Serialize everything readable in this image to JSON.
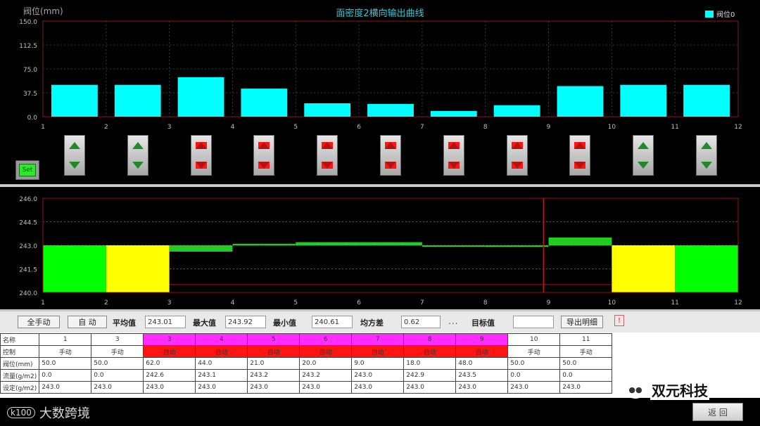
{
  "top_chart": {
    "title": "面密度2横向输出曲线",
    "unit_label": "阀位(mm)",
    "legend_label": "阀位0",
    "y_ticks": [
      "150.0",
      "112.5",
      "75.0",
      "37.5",
      "0.0"
    ],
    "x_ticks": [
      "1",
      "2",
      "3",
      "4",
      "5",
      "6",
      "7",
      "8",
      "9",
      "10",
      "11",
      "12"
    ],
    "set_label": "Set",
    "arrows": [
      {
        "color": "green"
      },
      {
        "color": "green"
      },
      {
        "color": "red"
      },
      {
        "color": "red"
      },
      {
        "color": "red"
      },
      {
        "color": "red"
      },
      {
        "color": "red"
      },
      {
        "color": "red"
      },
      {
        "color": "red"
      },
      {
        "color": "green"
      },
      {
        "color": "green"
      }
    ]
  },
  "chart_data": [
    {
      "type": "bar",
      "title": "面密度2横向输出曲线",
      "ylabel": "阀位(mm)",
      "categories": [
        "1",
        "2",
        "3",
        "4",
        "5",
        "6",
        "7",
        "8",
        "9",
        "10",
        "11"
      ],
      "values": [
        50.0,
        50.0,
        62.0,
        44.0,
        21.0,
        20.0,
        9.0,
        18.0,
        48.0,
        50.0,
        50.0
      ],
      "ylim": [
        0,
        150
      ],
      "color": "#00ffff",
      "legend": [
        "阀位0"
      ]
    },
    {
      "type": "area",
      "y_ticks": [
        "246.0",
        "244.5",
        "243.0",
        "241.5",
        "240.0"
      ],
      "ylim": [
        240,
        246
      ],
      "x_ticks": [
        "1",
        "2",
        "3",
        "4",
        "5",
        "6",
        "7",
        "8",
        "9",
        "10",
        "11",
        "12"
      ],
      "zones": [
        {
          "from": 1,
          "to": 2,
          "value": 243.0,
          "color": "#00ff00"
        },
        {
          "from": 2,
          "to": 3,
          "value": 243.0,
          "color": "#ffff00"
        },
        {
          "from": 10,
          "to": 11,
          "value": 243.0,
          "color": "#ffff00"
        },
        {
          "from": 11,
          "to": 12,
          "value": 243.0,
          "color": "#00ff00"
        }
      ],
      "measured": [
        {
          "from": 3,
          "to": 4,
          "value": 242.6
        },
        {
          "from": 4,
          "to": 5,
          "value": 243.1
        },
        {
          "from": 5,
          "to": 6,
          "value": 243.2
        },
        {
          "from": 6,
          "to": 7,
          "value": 243.2
        },
        {
          "from": 7,
          "to": 8,
          "value": 243.0
        },
        {
          "from": 8,
          "to": 9,
          "value": 242.9
        },
        {
          "from": 9,
          "to": 10,
          "value": 243.5
        }
      ],
      "reference_lines": [
        246.0,
        240.5
      ],
      "marker_x": 8.92
    }
  ],
  "controls": {
    "manual_button": "全手动",
    "auto_button": "自 动",
    "avg_label": "平均值",
    "avg_value": "243.01",
    "max_label": "最大值",
    "max_value": "243.92",
    "min_label": "最小值",
    "min_value": "240.61",
    "variance_label": "均方差",
    "variance_value": "0.62",
    "dots": "...",
    "target_label": "目标值",
    "target_value": "",
    "export_button": "导出明细",
    "alert_icon": "!"
  },
  "table": {
    "row_headers": [
      "名称",
      "控制",
      "阀位(mm)",
      "流量(g/m2)",
      "设定(g/m2)"
    ],
    "columns": [
      {
        "name": "1",
        "mode": "手动",
        "valve": "50.0",
        "flow": "0.0",
        "setpoint": "243.0",
        "name_bg": "",
        "mode_bg": ""
      },
      {
        "name": "3",
        "mode": "手动",
        "valve": "50.0",
        "flow": "0.0",
        "setpoint": "243.0",
        "name_bg": "",
        "mode_bg": ""
      },
      {
        "name": "3",
        "mode": "自动",
        "valve": "62.0",
        "flow": "242.6",
        "setpoint": "243.0",
        "name_bg": "magenta",
        "mode_bg": "red"
      },
      {
        "name": "4",
        "mode": "自动",
        "valve": "44.0",
        "flow": "243.1",
        "setpoint": "243.0",
        "name_bg": "magenta",
        "mode_bg": "red"
      },
      {
        "name": "5",
        "mode": "自动",
        "valve": "21.0",
        "flow": "243.2",
        "setpoint": "243.0",
        "name_bg": "magenta",
        "mode_bg": "red"
      },
      {
        "name": "6",
        "mode": "自动",
        "valve": "20.0",
        "flow": "243.2",
        "setpoint": "243.0",
        "name_bg": "magenta",
        "mode_bg": "red"
      },
      {
        "name": "7",
        "mode": "自动",
        "valve": "9.0",
        "flow": "243.0",
        "setpoint": "243.0",
        "name_bg": "magenta",
        "mode_bg": "red"
      },
      {
        "name": "8",
        "mode": "自动",
        "valve": "18.0",
        "flow": "242.9",
        "setpoint": "243.0",
        "name_bg": "magenta",
        "mode_bg": "red"
      },
      {
        "name": "9",
        "mode": "自动",
        "valve": "48.0",
        "flow": "243.5",
        "setpoint": "243.0",
        "name_bg": "magenta",
        "mode_bg": "red"
      },
      {
        "name": "10",
        "mode": "手动",
        "valve": "50.0",
        "flow": "0.0",
        "setpoint": "243.0",
        "name_bg": "",
        "mode_bg": ""
      },
      {
        "name": "11",
        "mode": "手动",
        "valve": "50.0",
        "flow": "0.0",
        "setpoint": "243.0",
        "name_bg": "",
        "mode_bg": ""
      }
    ]
  },
  "footer": {
    "watermark_left": "大数跨境",
    "watermark_logo": "k100",
    "watermark_right": "双元科技",
    "back_button": "返 回"
  }
}
